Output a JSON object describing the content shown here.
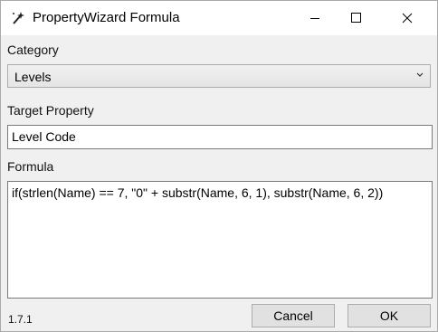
{
  "window": {
    "title": "PropertyWizard Formula",
    "icon": "wand-icon"
  },
  "category": {
    "label": "Category",
    "selected": "Levels"
  },
  "target_property": {
    "label": "Target Property",
    "value": "Level Code"
  },
  "formula": {
    "label": "Formula",
    "value": "if(strlen(Name) == 7, \"0\" + substr(Name, 6, 1), substr(Name, 6, 2))"
  },
  "footer": {
    "version": "1.7.1",
    "cancel_label": "Cancel",
    "ok_label": "OK"
  }
}
